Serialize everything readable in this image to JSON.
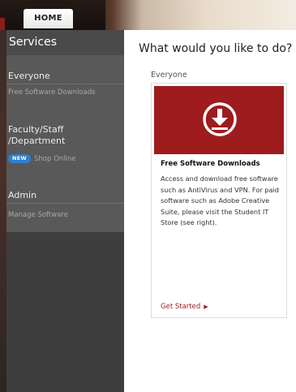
{
  "nav": {
    "home_label": "HOME"
  },
  "sidebar": {
    "title": "Services",
    "sections": [
      {
        "heading": "Everyone",
        "items": [
          "Free Software Downloads"
        ]
      },
      {
        "heading": "Faculty/Staff /Department",
        "items": [
          "Shop Online"
        ],
        "badge": "NEW"
      },
      {
        "heading": "Admin",
        "items": [
          "Manage Software"
        ]
      }
    ]
  },
  "main": {
    "title": "What would you like to do?",
    "subhead": "Everyone",
    "card": {
      "icon": "download-icon",
      "title": "Free Software Downloads",
      "description": "Access and download free software such as AntiVirus and VPN. For paid software such as Adobe Creative Suite, please visit the Student IT Store (see right).",
      "cta": "Get Started"
    }
  },
  "colors": {
    "accent_red": "#9e1b1e",
    "sidebar_bg": "#595959",
    "badge_blue": "#2d7fd0"
  }
}
